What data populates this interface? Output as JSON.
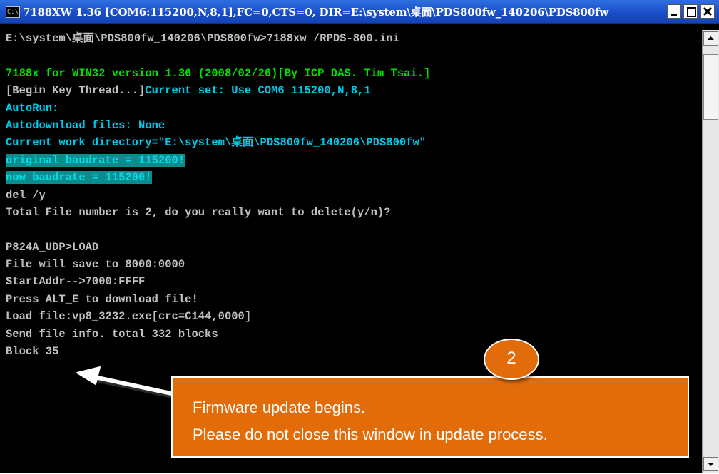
{
  "window": {
    "title": "7188XW 1.36 [COM6:115200,N,8,1],FC=0,CTS=0, DIR=E:\\system\\桌面\\PDS800fw_140206\\PDS800fw",
    "icon_text": "C:\\",
    "buttons": [
      "minimize-icon",
      "maximize-icon",
      "close-icon"
    ]
  },
  "console": {
    "lines": [
      {
        "text": "E:\\system\\桌面\\PDS800fw_140206\\PDS800fw>7188xw /RPDS-800.ini",
        "color": "gray"
      },
      {
        "text": "",
        "color": "gray"
      },
      {
        "text": "7188x for WIN32 version 1.36 (2008/02/26)[By ICP DAS. Tim Tsai.]",
        "color": "green"
      },
      {
        "text_a": "[Begin Key Thread...]",
        "text_b": "Current set: Use COM6 115200,N,8,1",
        "color": "mixed"
      },
      {
        "text": "AutoRun:",
        "color": "cyan"
      },
      {
        "text": "Autodownload files: None",
        "color": "cyan"
      },
      {
        "text": "Current work directory=\"E:\\system\\桌面\\PDS800fw_140206\\PDS800fw\"",
        "color": "cyan"
      },
      {
        "text": "original baudrate = 115200!",
        "color": "highlight"
      },
      {
        "text": "now baudrate = 115200!",
        "color": "highlight"
      },
      {
        "text": "del /y",
        "color": "gray"
      },
      {
        "text": "Total File number is 2, do you really want to delete(y/n)?",
        "color": "gray"
      },
      {
        "text": "",
        "color": "gray"
      },
      {
        "text": "P824A_UDP>LOAD",
        "color": "gray"
      },
      {
        "text": "File will save to 8000:0000",
        "color": "gray"
      },
      {
        "text": "StartAddr-->7000:FFFF",
        "color": "gray"
      },
      {
        "text": "Press ALT_E to download file!",
        "color": "gray"
      },
      {
        "text": "Load file:vp8_3232.exe[crc=C144,0000]",
        "color": "gray"
      },
      {
        "text": "Send file info. total 332 blocks",
        "color": "gray"
      },
      {
        "text": "Block 35",
        "color": "gray"
      }
    ]
  },
  "callout": {
    "step": "2",
    "line1": "Firmware update begins.",
    "line2": "Please do not close this window in update process.",
    "color": "#e36c0a"
  },
  "colors": {
    "console_bg": "#000000",
    "text_gray": "#c0c0c0",
    "text_green": "#00e000",
    "text_cyan": "#00c8e8",
    "highlight_bg": "#0a8c8c"
  }
}
